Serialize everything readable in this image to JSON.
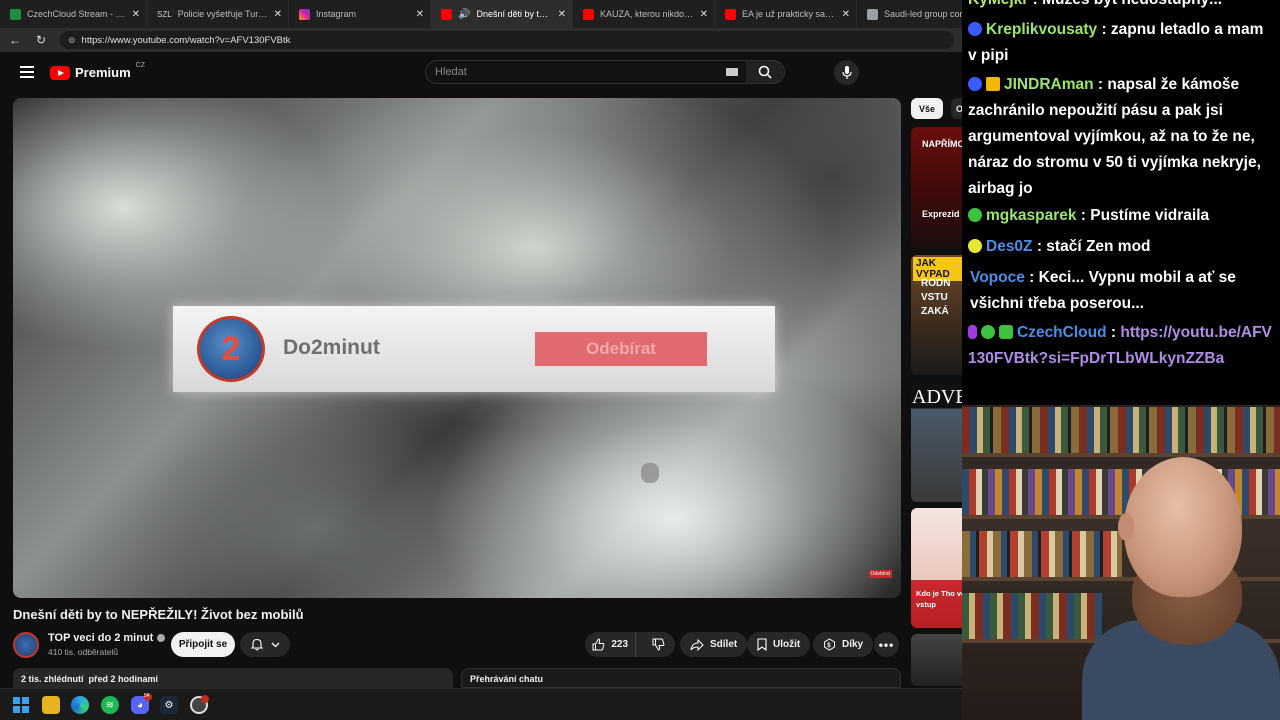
{
  "browser": {
    "tabs": [
      {
        "title": "CzechCloud Stream - Watch",
        "color": "#1e8e3e"
      },
      {
        "title": "Policie vyšetřuje Turkovu neh",
        "color": "#888888"
      },
      {
        "title": "Instagram",
        "color": "#d6249f"
      },
      {
        "title": "Dnešní děti by to NEPŘE",
        "color": "#ff0000",
        "active": true
      },
      {
        "title": "KAUZA, kterou nikdo NECHÁ",
        "color": "#ff0000"
      },
      {
        "title": "EA je už prakticky saúdská. E",
        "color": "#ff0000"
      },
      {
        "title": "Saudi-led group complet",
        "color": "#9aa0a6"
      }
    ],
    "tab_prefix_2": "SZL",
    "url": "https://www.youtube.com/watch?v=AFV130FVBtk"
  },
  "youtube": {
    "logo_text": "Premium",
    "country_code": "CZ",
    "search_placeholder": "Hledat",
    "video": {
      "banner_channel": "Do2minut",
      "banner_button": "Odebírat",
      "watermark": "Odebírat"
    },
    "title": "Dnešní děti by to NEPŘEŽILY! Život bez mobilů",
    "channel": {
      "name": "TOP veci do 2 minut",
      "subscribers": "410 tis. odběratelů"
    },
    "join_label": "Připojit se",
    "likes": "223",
    "share_label": "Sdílet",
    "save_label": "Uložit",
    "thanks_label": "Díky",
    "views_date": "2 tis. zhlédnutí  před 2 hodinami",
    "chat_replay": "Přehrávání chatu",
    "chips": [
      "Vše",
      "O"
    ],
    "recommendations": [
      {
        "line1": "NAPŘÍMO",
        "line2": "Exprezid"
      },
      {
        "line1": "JAK VYPAD",
        "line2": "RODN VSTU ZAKÁ"
      },
      {
        "line1": "ADVE"
      },
      {
        "line1": "Kdo je Tho ve vstup"
      }
    ]
  },
  "chat": {
    "messages": [
      {
        "user": "KyMejkr",
        "user_color": "#b8e86a",
        "text": ": Můžeš být nedostupný..."
      },
      {
        "user": "Kreplikvousaty",
        "user_color": "#9ae66e",
        "text": ": zapnu letadlo a mam v pipi",
        "badges": [
          "#3b5bff"
        ]
      },
      {
        "user": "JINDRAman",
        "user_color": "#9ae66e",
        "text": ": napsal že kámoše zachránilo nepoužití pásu a pak jsi argumentoval vyjímkou, až na to že ne, náraz do stromu v 50 ti vyjímka nekryje, airbag jo",
        "badges": [
          "#3b5bff",
          "#f5b400"
        ]
      },
      {
        "user": "mgkasparek",
        "user_color": "#9ae66e",
        "text": ": Pustíme vidraila",
        "badges": [
          "#3cc23c"
        ]
      },
      {
        "user": "Des0Z",
        "user_color": "#4b8ee8",
        "text": ": stačí Zen mod",
        "badges": [
          "#e6e635"
        ]
      },
      {
        "user": "Vopoce",
        "user_color": "#4b8ee8",
        "text": ": Keci... Vypnu mobil a ať se všichni třeba poserou..."
      },
      {
        "user": "CzechCloud",
        "user_color": "#4b8ee8",
        "text": ":",
        "link": "https://youtu.be/AFV130FVBtk?si=FpDrTLbWLkynZZBa",
        "badges": [
          "#a23ce0",
          "#3cc23c",
          "#3cc23c"
        ]
      }
    ]
  },
  "taskbar": {
    "apps": [
      "windows-start",
      "file-explorer",
      "edge",
      "spotify",
      "discord",
      "steam",
      "obs"
    ],
    "discord_badge": "54"
  }
}
